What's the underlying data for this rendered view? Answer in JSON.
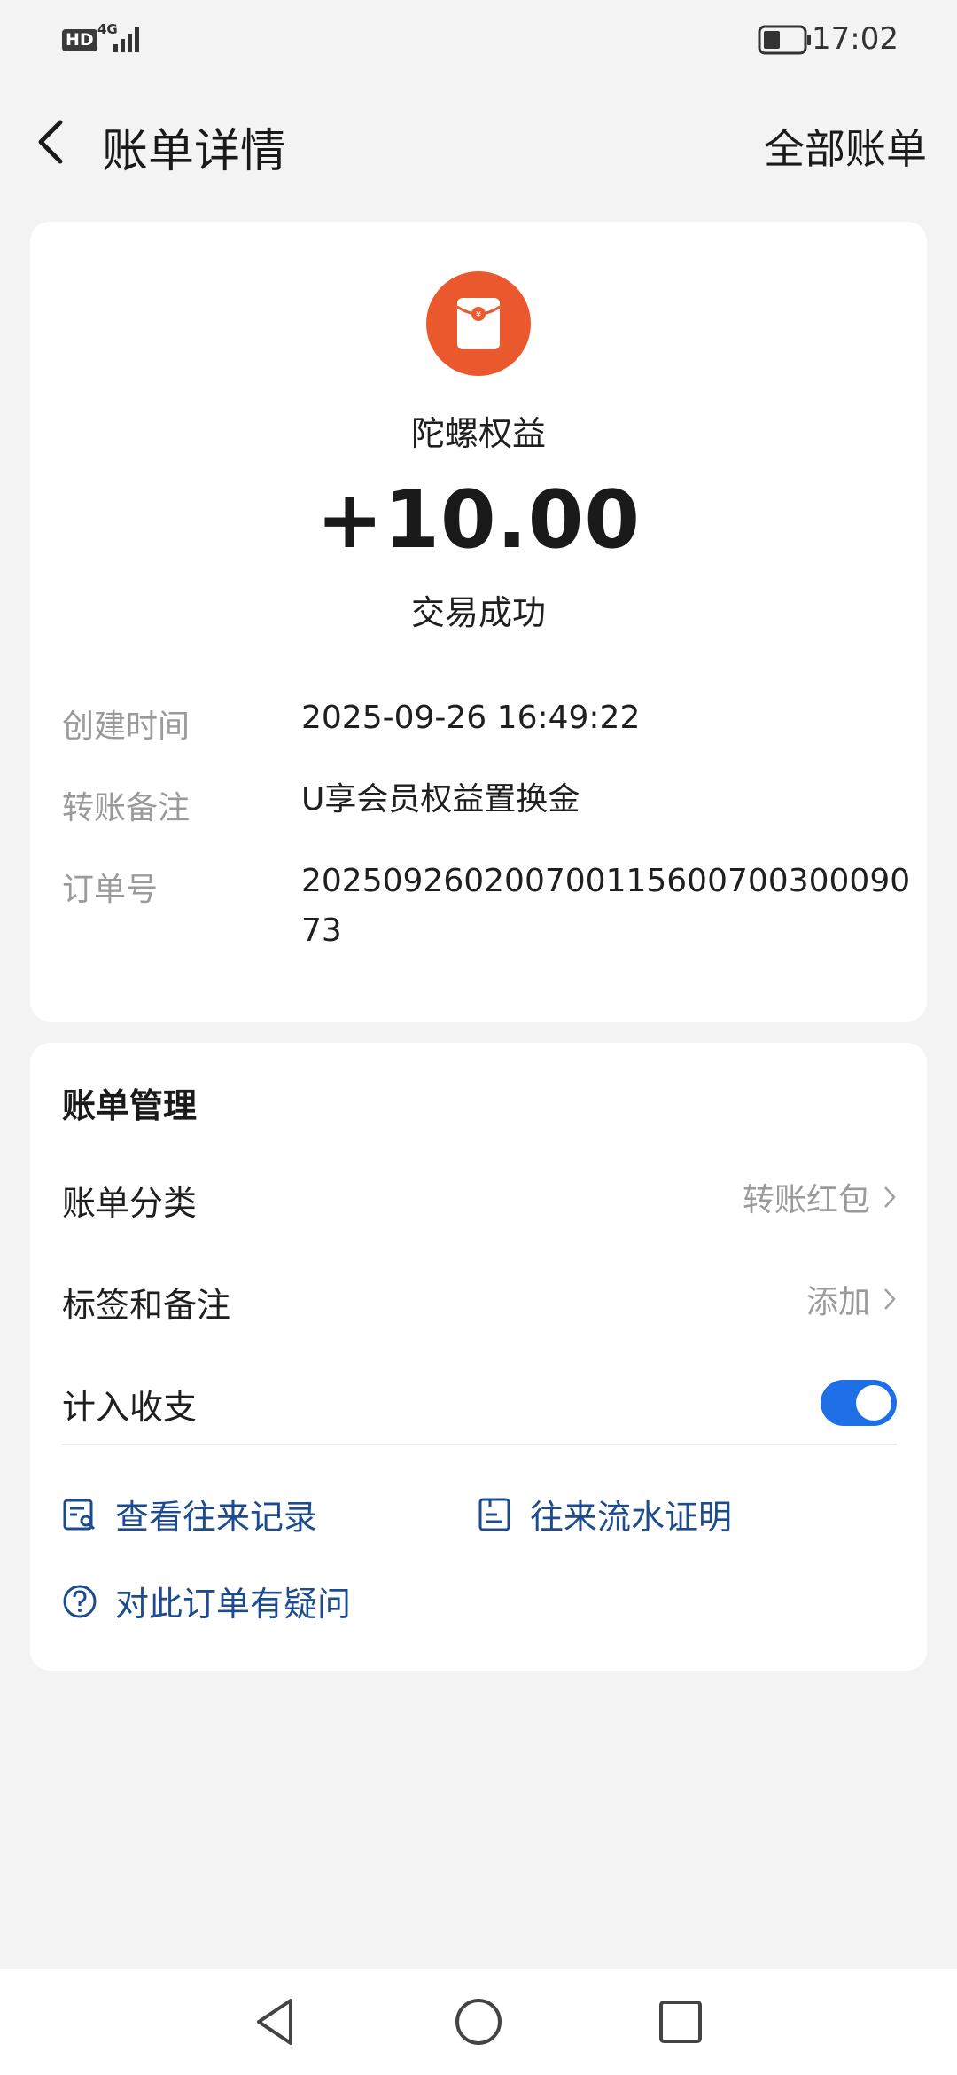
{
  "status_bar": {
    "hd": "HD",
    "network": "4G",
    "time": "17:02",
    "icons": [
      "signal-icon",
      "battery-icon"
    ]
  },
  "header": {
    "title": "账单详情",
    "all_bills": "全部账单"
  },
  "transaction": {
    "icon": "red-packet-icon",
    "icon_color": "#e9592d",
    "merchant": "陀螺权益",
    "amount": "+10.00",
    "status": "交易成功"
  },
  "details": [
    {
      "label": "创建时间",
      "value": "2025-09-26 16:49:22"
    },
    {
      "label": "转账备注",
      "value": "U享会员权益置换金"
    },
    {
      "label": "订单号",
      "value": "20250926020070011560070030009073"
    }
  ],
  "management": {
    "title": "账单管理",
    "category_label": "账单分类",
    "category_value": "转账红包",
    "tag_label": "标签和备注",
    "tag_value": "添加",
    "include_label": "计入收支",
    "include_on": true,
    "accent_color": "#1e6fe6",
    "links": {
      "records": "查看往来记录",
      "proof": "往来流水证明",
      "question": "对此订单有疑问"
    }
  },
  "nav_icons": [
    "back-nav-icon",
    "home-nav-icon",
    "recents-nav-icon"
  ]
}
